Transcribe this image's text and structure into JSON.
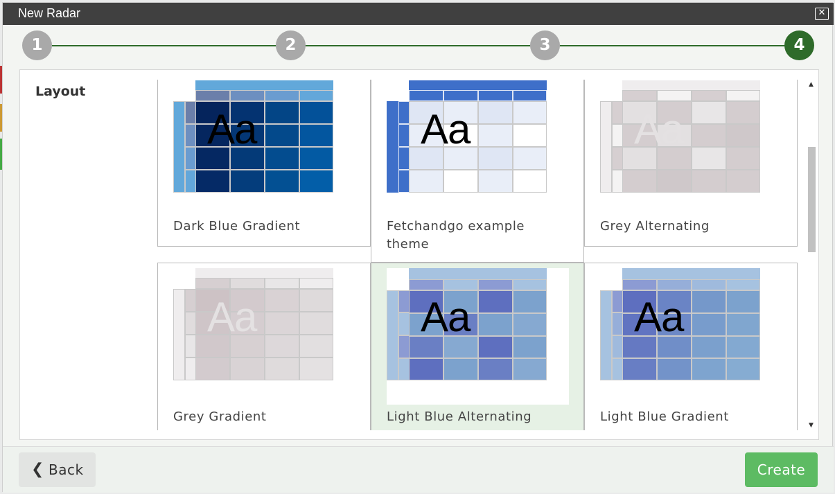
{
  "dialog": {
    "title": "New Radar",
    "close_icon": "close-icon"
  },
  "stepper": {
    "steps": [
      {
        "label": "1",
        "state": "complete"
      },
      {
        "label": "2",
        "state": "complete"
      },
      {
        "label": "3",
        "state": "complete"
      },
      {
        "label": "4",
        "state": "active"
      }
    ],
    "colors": {
      "active": "#2e6b2a",
      "inactive": "#a9a9a9",
      "line": "#2e6b2a"
    }
  },
  "section": {
    "label": "Layout"
  },
  "themes": [
    {
      "name": "Dark Blue Gradient",
      "selected": false
    },
    {
      "name": "Fetchandgo example theme",
      "selected": false
    },
    {
      "name": "Grey Alternating",
      "selected": false
    },
    {
      "name": "Grey Gradient",
      "selected": false
    },
    {
      "name": "Light Blue Alternating",
      "selected": true
    },
    {
      "name": "Light Blue Gradient",
      "selected": false
    }
  ],
  "preview_text": "Aa",
  "footer": {
    "back_label": "Back",
    "create_label": "Create",
    "back_icon": "chevron-left-icon"
  },
  "colors": {
    "titlebar": "#404040",
    "create_button": "#5dbb63",
    "selected_card": "#e6f1e5"
  }
}
